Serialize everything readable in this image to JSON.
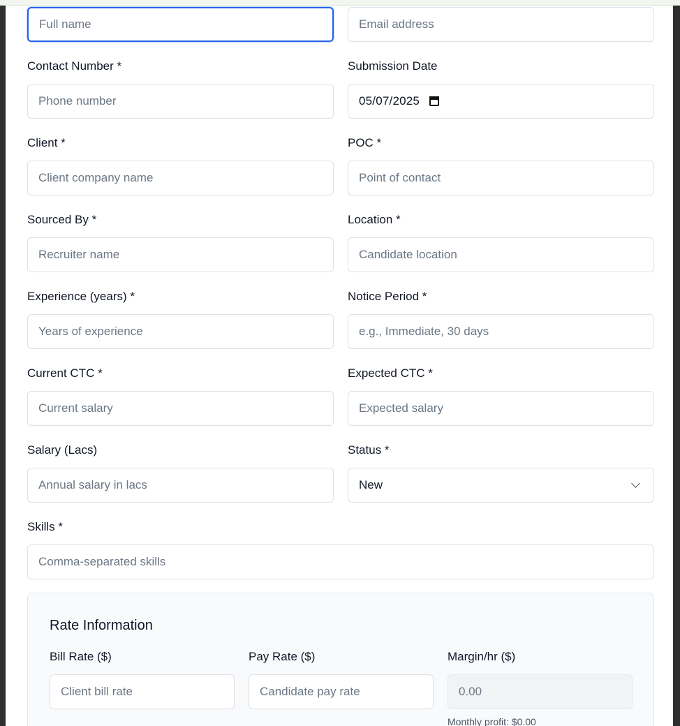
{
  "form": {
    "full_name": {
      "placeholder": "Full name"
    },
    "email": {
      "placeholder": "Email address"
    },
    "contact_number": {
      "label": "Contact Number *",
      "placeholder": "Phone number"
    },
    "submission_date": {
      "label": "Submission Date",
      "value": "05/07/2025"
    },
    "client": {
      "label": "Client *",
      "placeholder": "Client company name"
    },
    "poc": {
      "label": "POC *",
      "placeholder": "Point of contact"
    },
    "sourced_by": {
      "label": "Sourced By *",
      "placeholder": "Recruiter name"
    },
    "location": {
      "label": "Location *",
      "placeholder": "Candidate location"
    },
    "experience": {
      "label": "Experience (years) *",
      "placeholder": "Years of experience"
    },
    "notice_period": {
      "label": "Notice Period *",
      "placeholder": "e.g., Immediate, 30 days"
    },
    "current_ctc": {
      "label": "Current CTC *",
      "placeholder": "Current salary"
    },
    "expected_ctc": {
      "label": "Expected CTC *",
      "placeholder": "Expected salary"
    },
    "salary_lacs": {
      "label": "Salary (Lacs)",
      "placeholder": "Annual salary in lacs"
    },
    "status": {
      "label": "Status *",
      "value": "New"
    },
    "skills": {
      "label": "Skills *",
      "placeholder": "Comma-separated skills"
    }
  },
  "rate_info": {
    "title": "Rate Information",
    "bill_rate": {
      "label": "Bill Rate ($)",
      "placeholder": "Client bill rate"
    },
    "pay_rate": {
      "label": "Pay Rate ($)",
      "placeholder": "Candidate pay rate"
    },
    "margin": {
      "label": "Margin/hr ($)",
      "placeholder": "0.00"
    },
    "monthly_profit": "Monthly profit: $0.00"
  },
  "colors": {
    "focus": "#2563eb",
    "border": "#dde1e6",
    "panel_bg": "#f8fafc"
  },
  "icons": [
    "calendar-icon",
    "chevron-down-icon"
  ]
}
